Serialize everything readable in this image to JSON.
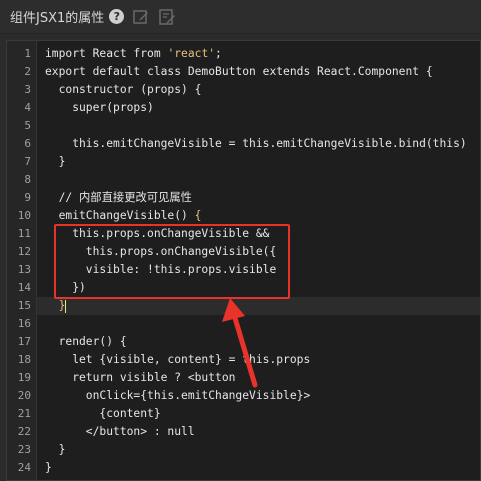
{
  "header": {
    "title": "组件JSX1的属性",
    "help_glyph": "?",
    "icons": [
      "help-icon",
      "edit-icon",
      "edit-alt-icon"
    ]
  },
  "editor": {
    "lines": [
      {
        "n": "1",
        "code": "import React from 'react';"
      },
      {
        "n": "2",
        "code": "export default class DemoButton extends React.Component {"
      },
      {
        "n": "3",
        "code": "  constructor (props) {"
      },
      {
        "n": "4",
        "code": "    super(props)"
      },
      {
        "n": "5",
        "code": ""
      },
      {
        "n": "6",
        "code": "    this.emitChangeVisible = this.emitChangeVisible.bind(this)"
      },
      {
        "n": "7",
        "code": "  }"
      },
      {
        "n": "8",
        "code": ""
      },
      {
        "n": "9",
        "code": "  // 内部直接更改可见属性"
      },
      {
        "n": "10",
        "code": "  emitChangeVisible() {"
      },
      {
        "n": "11",
        "code": "    this.props.onChangeVisible &&"
      },
      {
        "n": "12",
        "code": "      this.props.onChangeVisible({"
      },
      {
        "n": "13",
        "code": "      visible: !this.props.visible"
      },
      {
        "n": "14",
        "code": "    })"
      },
      {
        "n": "15",
        "code": "  }"
      },
      {
        "n": "16",
        "code": ""
      },
      {
        "n": "17",
        "code": "  render() {"
      },
      {
        "n": "18",
        "code": "    let {visible, content} = this.props"
      },
      {
        "n": "19",
        "code": "    return visible ? <button"
      },
      {
        "n": "20",
        "code": "      onClick={this.emitChangeVisible}>"
      },
      {
        "n": "21",
        "code": "        {content}"
      },
      {
        "n": "22",
        "code": "      </button> : null"
      },
      {
        "n": "23",
        "code": "  }"
      },
      {
        "n": "24",
        "code": "}"
      }
    ],
    "active_line": 15
  },
  "annotation": {
    "box_color": "#e8332a",
    "arrow_color": "#e8332a"
  }
}
